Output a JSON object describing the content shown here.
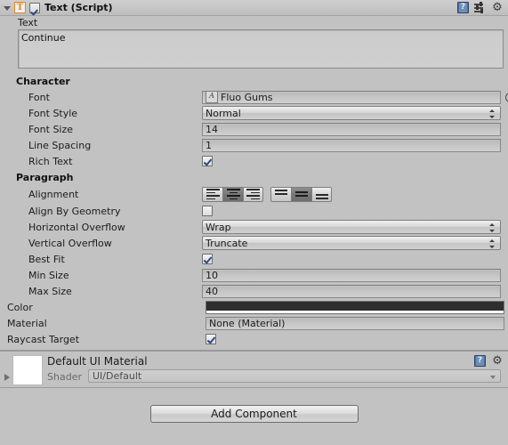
{
  "component": {
    "title": "Text (Script)",
    "icon_letter": "T",
    "enabled_checkbox": true,
    "expanded": true,
    "header_icons": [
      "help-icon",
      "preset-icon",
      "gear-icon"
    ]
  },
  "text_property": {
    "label": "Text",
    "value": "Continue"
  },
  "character": {
    "section_label": "Character",
    "font": {
      "label": "Font",
      "value": "Fluo Gums"
    },
    "font_style": {
      "label": "Font Style",
      "value": "Normal"
    },
    "font_size": {
      "label": "Font Size",
      "value": "14"
    },
    "line_spacing": {
      "label": "Line Spacing",
      "value": "1"
    },
    "rich_text": {
      "label": "Rich Text",
      "checked": true
    }
  },
  "paragraph": {
    "section_label": "Paragraph",
    "alignment": {
      "label": "Alignment",
      "horizontal_options": [
        "align-left",
        "align-center",
        "align-right"
      ],
      "horizontal_selected": 1,
      "vertical_options": [
        "align-top",
        "align-middle",
        "align-bottom"
      ],
      "vertical_selected": 1
    },
    "align_by_geometry": {
      "label": "Align By Geometry",
      "checked": false
    },
    "horizontal_overflow": {
      "label": "Horizontal Overflow",
      "value": "Wrap"
    },
    "vertical_overflow": {
      "label": "Vertical Overflow",
      "value": "Truncate"
    },
    "best_fit": {
      "label": "Best Fit",
      "checked": true
    },
    "min_size": {
      "label": "Min Size",
      "value": "10"
    },
    "max_size": {
      "label": "Max Size",
      "value": "40"
    }
  },
  "color": {
    "label": "Color",
    "swatch_hex": "#2e2e2e",
    "alpha_hex": "#ffffff"
  },
  "material": {
    "label": "Material",
    "value": "None (Material)"
  },
  "raycast_target": {
    "label": "Raycast Target",
    "checked": true
  },
  "material_block": {
    "title": "Default UI Material",
    "shader_label": "Shader",
    "shader_value": "UI/Default",
    "icons": [
      "help-icon",
      "gear-icon"
    ]
  },
  "add_component": {
    "label": "Add Component"
  }
}
